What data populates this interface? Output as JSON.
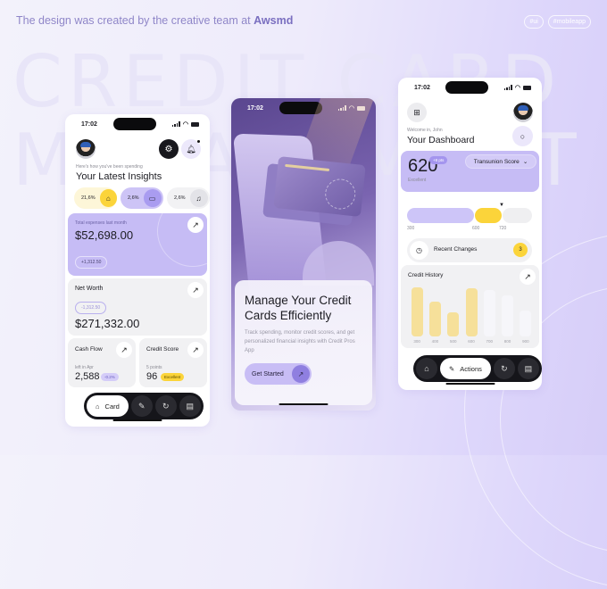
{
  "background": {
    "headline_line1": "CREDIT CARD",
    "headline_line2": "MANAGEMENT"
  },
  "tagline": {
    "text": "The design was created by the creative team at ",
    "brand": "Awsmd"
  },
  "tags": [
    "#ui",
    "#mobileapp"
  ],
  "status_time": "17:02",
  "phone1": {
    "subtitle": "Here's how you've been spending",
    "title": "Your Latest Insights",
    "chips": [
      {
        "value": "21,6%",
        "icon": "home-icon",
        "color": "#fbd43a"
      },
      {
        "value": "2,6%",
        "icon": "wallet-icon",
        "color": "#a99cf0"
      },
      {
        "value": "2,6%",
        "icon": "headphones-icon",
        "color": "#e6e6ea"
      }
    ],
    "expenses": {
      "label": "Total expenses last month",
      "amount": "$52,698.00",
      "delta": "+1,312.50"
    },
    "net_worth": {
      "label": "Net Worth",
      "delta": "-1,312.50",
      "amount": "$271,332.00"
    },
    "cash_flow": {
      "label": "Cash Flow",
      "sub": "left in Apr",
      "value": "2,588",
      "badge": "-0.2%"
    },
    "credit_score": {
      "label": "Credit Score",
      "sub": "5 points",
      "value": "96",
      "badge": "Excellent"
    },
    "nav": {
      "active_label": "Card",
      "icons": [
        "home-icon",
        "pencil-icon",
        "rotate-icon",
        "book-icon"
      ]
    }
  },
  "phone2": {
    "title": "Manage Your Credit Cards Efficiently",
    "description": "Track spending, monitor credit scores, and get personalized financial insights with Credit Pros App",
    "cta": "Get Started"
  },
  "phone3": {
    "welcome": "Welcome in, John",
    "title": "Your Dashboard",
    "score": "620",
    "score_badge": "+8 pts",
    "score_label": "Excellent",
    "score_source": "Transunion Score",
    "range_ticks": [
      "300",
      "600",
      "720"
    ],
    "recent_changes": {
      "label": "Recent Changes",
      "count": "3"
    },
    "credit_history": {
      "title": "Credit History"
    },
    "nav": {
      "active_label": "Actions"
    }
  },
  "chart_data": {
    "type": "bar",
    "title": "Credit History",
    "categories": [
      "300",
      "400",
      "500",
      "600",
      "700",
      "800",
      "900"
    ],
    "values": [
      0.95,
      0.68,
      0.47,
      0.93,
      0.9,
      0.8,
      0.5
    ],
    "highlight": [
      true,
      true,
      true,
      true,
      false,
      false,
      false
    ],
    "colors": {
      "active": "#f6e09a",
      "inactive": "#f6f6fa"
    },
    "xlabel": "",
    "ylabel": ""
  }
}
